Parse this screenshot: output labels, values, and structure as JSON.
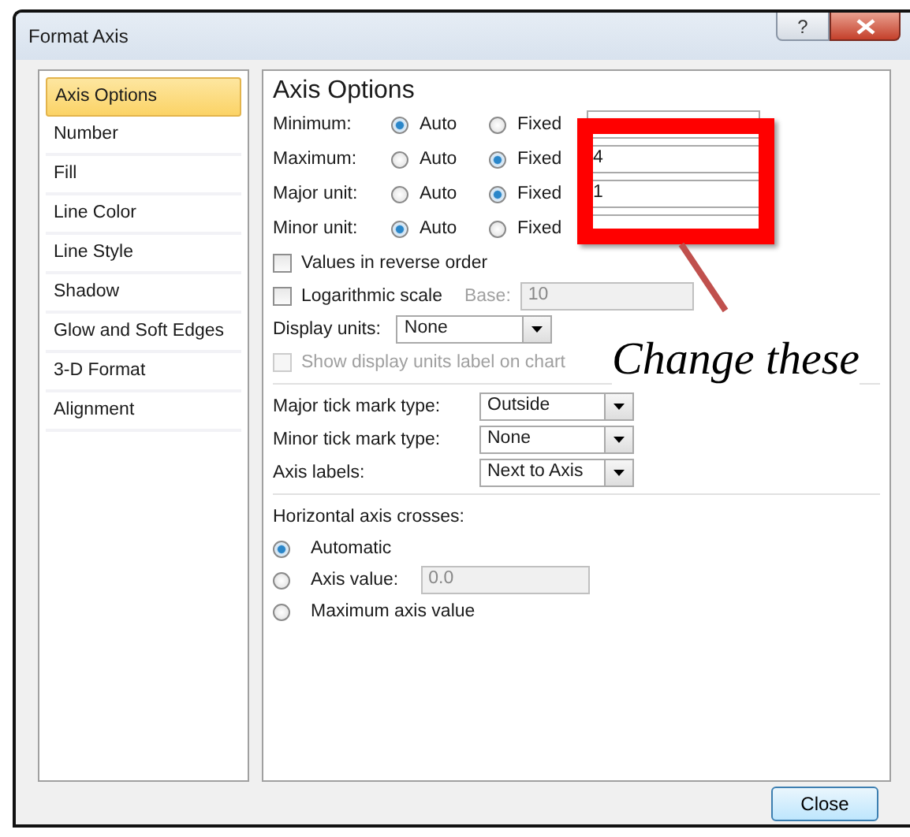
{
  "window": {
    "title": "Format Axis",
    "help_button": "?"
  },
  "sidebar": {
    "items": [
      {
        "label": "Axis Options",
        "selected": true
      },
      {
        "label": "Number",
        "selected": false
      },
      {
        "label": "Fill",
        "selected": false
      },
      {
        "label": "Line Color",
        "selected": false
      },
      {
        "label": "Line Style",
        "selected": false
      },
      {
        "label": "Shadow",
        "selected": false
      },
      {
        "label": "Glow and Soft Edges",
        "selected": false
      },
      {
        "label": "3-D Format",
        "selected": false
      },
      {
        "label": "Alignment",
        "selected": false
      }
    ]
  },
  "panel": {
    "heading": "Axis Options",
    "bounds": [
      {
        "label": "Minimum:",
        "options": [
          {
            "label": "Auto",
            "selected": true
          },
          {
            "label": "Fixed",
            "selected": false
          }
        ]
      },
      {
        "label": "Maximum:",
        "options": [
          {
            "label": "Auto",
            "selected": false
          },
          {
            "label": "Fixed",
            "selected": true
          }
        ],
        "value": "4"
      },
      {
        "label": "Major unit:",
        "options": [
          {
            "label": "Auto",
            "selected": false
          },
          {
            "label": "Fixed",
            "selected": true
          }
        ],
        "value": "1"
      },
      {
        "label": "Minor unit:",
        "options": [
          {
            "label": "Auto",
            "selected": true
          },
          {
            "label": "Fixed",
            "selected": false
          }
        ]
      }
    ],
    "reverse_order": {
      "label": "Values in reverse order",
      "checked": false
    },
    "log_scale": {
      "label": "Logarithmic scale",
      "checked": false,
      "base_label": "Base:",
      "base_value": "10",
      "base_disabled": true
    },
    "display_units": {
      "label": "Display units:",
      "value": "None"
    },
    "show_units_label": {
      "label": "Show display units label on chart",
      "checked": false,
      "disabled": true
    },
    "dropdowns": [
      {
        "label": "Major tick mark type:",
        "value": "Outside"
      },
      {
        "label": "Minor tick mark type:",
        "value": "None"
      },
      {
        "label": "Axis labels:",
        "value": "Next to Axis"
      }
    ],
    "crosses": {
      "label": "Horizontal axis crosses:",
      "options": [
        {
          "label": "Automatic",
          "selected": true
        },
        {
          "label": "Axis value:",
          "selected": false,
          "value": "0.0"
        },
        {
          "label": "Maximum axis value",
          "selected": false
        }
      ]
    }
  },
  "annotation": {
    "text": "Change these"
  },
  "buttons": [
    "Close"
  ]
}
